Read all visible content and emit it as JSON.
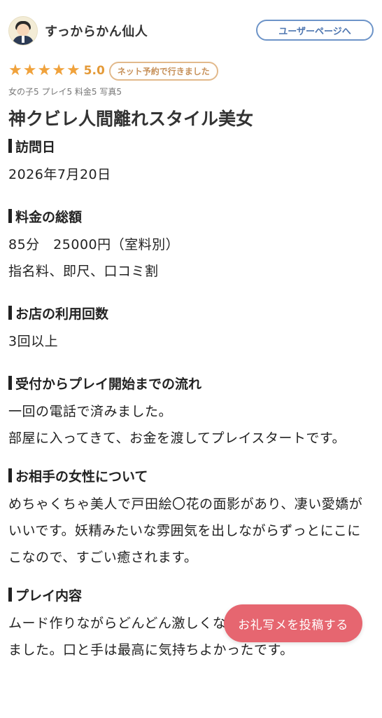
{
  "user": {
    "name": "すっからかん仙人",
    "user_page_button": "ユーザーページへ"
  },
  "rating": {
    "stars": 5,
    "score": "5.0",
    "booking_badge": "ネット予約で行きました",
    "sub_ratings": "女の子5 プレイ5 料金5 写真5",
    "star_color": "#f0a23c"
  },
  "review": {
    "title": "神クビレ人間離れスタイル美女",
    "sections": {
      "visit_date": {
        "heading": "訪問日",
        "body": [
          "2026年7月20日"
        ]
      },
      "total_price": {
        "heading": "料金の総額",
        "body": [
          "85分　25000円（室料別）",
          "指名料、即尺、口コミ割"
        ]
      },
      "visit_count": {
        "heading": "お店の利用回数",
        "body": [
          "3回以上"
        ]
      },
      "flow": {
        "heading": "受付からプレイ開始までの流れ",
        "body": [
          "一回の電話で済みました。",
          "部屋に入ってきて、お金を渡してプレイスタートです。"
        ]
      },
      "partner": {
        "heading": "お相手の女性について",
        "body": [
          "めちゃくちゃ美人で戸田絵〇花の面影があり、凄い愛嬌がいいです。妖精みたいな雰囲気を出しながらずっとにこにこなので、すごい癒されます。"
        ]
      },
      "play": {
        "heading": "プレイ内容",
        "body": [
          "ムード作りながらどんどん激しくなっていったのが興奮しました。口と手は最高に気持ちよかったです。"
        ]
      }
    }
  },
  "fab": {
    "label": "お礼写メを投稿する",
    "color": "#e66670"
  },
  "colors": {
    "button_border": "#6d94c8",
    "badge_border": "#e2b98b"
  }
}
